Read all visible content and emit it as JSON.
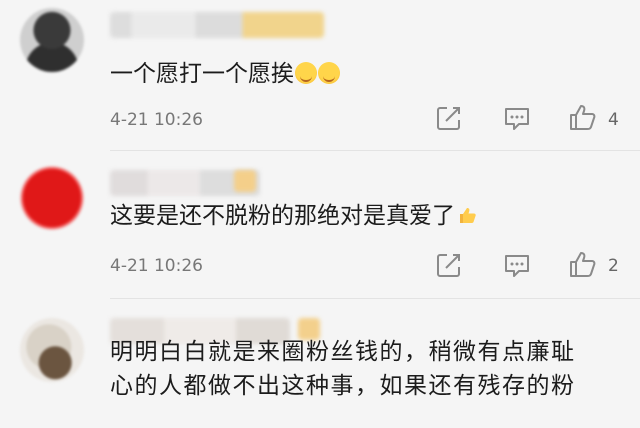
{
  "comments": [
    {
      "text": "一个愿打一个愿挨",
      "emojis": [
        "face-icon",
        "face-icon"
      ],
      "time": "4-21 10:26",
      "like_count": "4"
    },
    {
      "text": "这要是还不脱粉的那绝对是真爱了",
      "emojis": [
        "thumbs-up-icon"
      ],
      "time": "4-21 10:26",
      "like_count": "2"
    },
    {
      "text_line1": "明明白白就是来圈粉丝钱的，稍微有点廉耻",
      "text_line2": "心的人都做不出这种事，如果还有残存的粉"
    }
  ],
  "colors": {
    "background": "#f5f5f5",
    "text": "#1c1c1c",
    "meta": "#777777",
    "icon": "#8a8a8a"
  }
}
